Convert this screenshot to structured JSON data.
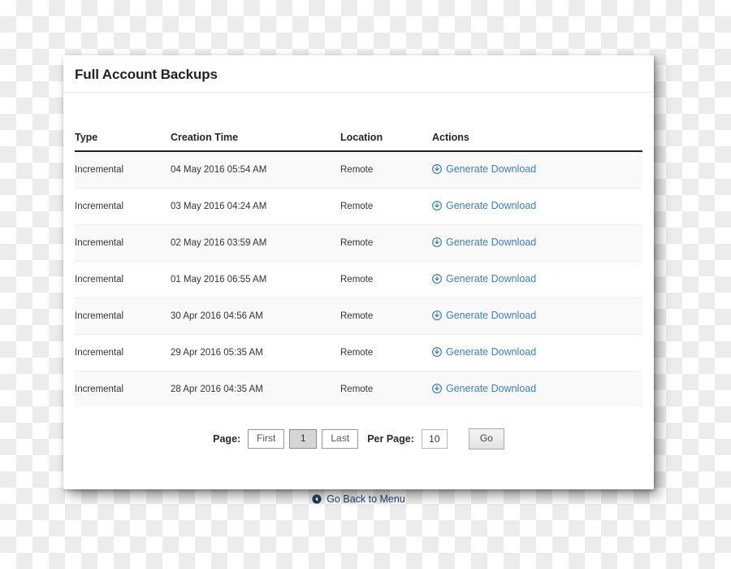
{
  "card": {
    "title": "Full Account Backups"
  },
  "table": {
    "columns": [
      "Type",
      "Creation Time",
      "Location",
      "Actions"
    ],
    "rows": [
      {
        "type": "Incremental",
        "time": "04 May 2016 05:54 AM",
        "location": "Remote",
        "action": "Generate Download",
        "action_icon": "download-circle-icon"
      },
      {
        "type": "Incremental",
        "time": "03 May 2016 04:24 AM",
        "location": "Remote",
        "action": "Generate Download",
        "action_icon": "download-circle-icon"
      },
      {
        "type": "Incremental",
        "time": "02 May 2016 03:59 AM",
        "location": "Remote",
        "action": "Generate Download",
        "action_icon": "download-circle-icon"
      },
      {
        "type": "Incremental",
        "time": "01 May 2016 06:55 AM",
        "location": "Remote",
        "action": "Generate Download",
        "action_icon": "download-circle-icon"
      },
      {
        "type": "Incremental",
        "time": "30 Apr 2016 04:56 AM",
        "location": "Remote",
        "action": "Generate Download",
        "action_icon": "download-circle-icon"
      },
      {
        "type": "Incremental",
        "time": "29 Apr 2016 05:35 AM",
        "location": "Remote",
        "action": "Generate Download",
        "action_icon": "download-circle-icon"
      },
      {
        "type": "Incremental",
        "time": "28 Apr 2016 04:35 AM",
        "location": "Remote",
        "action": "Generate Download",
        "action_icon": "download-circle-icon"
      }
    ]
  },
  "pagination": {
    "page_label": "Page:",
    "first_label": "First",
    "current_page": "1",
    "last_label": "Last",
    "per_page_label": "Per Page:",
    "per_page_value": "10",
    "go_label": "Go"
  },
  "footer": {
    "back_label": "Go Back to Menu",
    "back_icon": "arrow-left-circle-icon"
  },
  "colors": {
    "link_blue": "#3d7fc1",
    "back_link_navy": "#16395c",
    "header_rule": "#222222",
    "stripe": "#f9f9f9"
  }
}
